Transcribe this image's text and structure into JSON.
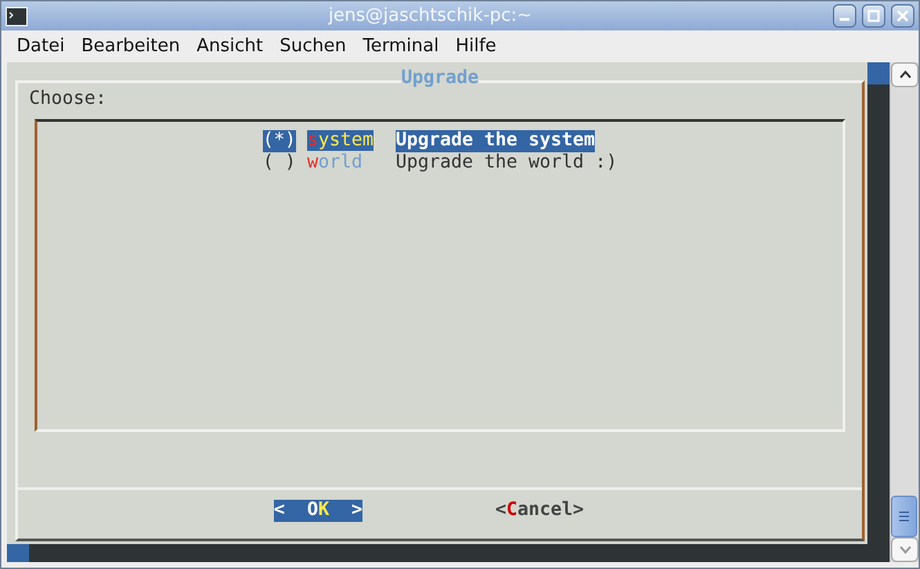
{
  "window": {
    "title": "jens@jaschtschik-pc:~"
  },
  "menu": [
    "Datei",
    "Bearbeiten",
    "Ansicht",
    "Suchen",
    "Terminal",
    "Hilfe"
  ],
  "dialog": {
    "title": "Upgrade",
    "prompt": "Choose:",
    "options": [
      {
        "marker": "(*)",
        "hotkey": "s",
        "rest": "ystem",
        "description": "Upgrade the system",
        "selected": true
      },
      {
        "marker": "( )",
        "hotkey": "w",
        "rest": "orld",
        "description": "Upgrade the world :)",
        "selected": false
      }
    ],
    "buttons": [
      {
        "segments": [
          {
            "text": "<  O",
            "accent": false
          },
          {
            "text": "K",
            "accent": true
          },
          {
            "text": "  >",
            "accent": false
          }
        ],
        "selected": true
      },
      {
        "segments": [
          {
            "text": "<",
            "accent": false
          },
          {
            "text": "C",
            "accent": true
          },
          {
            "text": "ancel>",
            "accent": false
          }
        ],
        "selected": false
      }
    ]
  }
}
